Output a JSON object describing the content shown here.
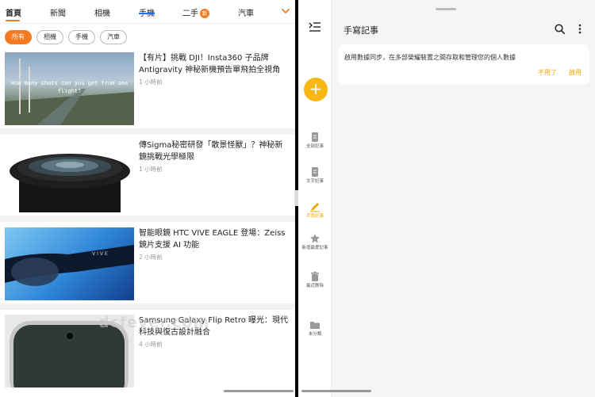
{
  "news": {
    "tabs": [
      {
        "label": "首頁"
      },
      {
        "label": "新聞"
      },
      {
        "label": "相機"
      },
      {
        "label": "手機"
      },
      {
        "label": "二手",
        "badge": "新"
      },
      {
        "label": "汽車"
      }
    ],
    "filter_chips": [
      "所有",
      "相機",
      "手機",
      "汽車"
    ],
    "articles": [
      {
        "title": "【有片】挑戰 DJI！Insta360 子品牌 Antigravity 神秘新機預告單飛拍全視角",
        "time": "1 小時前",
        "thumb_caption": "How many shots can you get from one flight?"
      },
      {
        "title": "傳Sigma秘密研發「散景怪獸」？神秘新鏡挑戰光學極限",
        "time": "1 小時前"
      },
      {
        "title": "智能眼鏡 HTC VIVE EAGLE 登場：Zeiss 鏡片支援 AI 功能",
        "time": "2 小時前",
        "thumb_caption": "VIVE"
      },
      {
        "title": "Samsung Galaxy Flip Retro 曝光：現代科技與復古設計融合",
        "time": "4 小時前"
      }
    ],
    "watermark": "dcfever.com"
  },
  "notes": {
    "title": "手寫記事",
    "nav": [
      {
        "label": "全部記事",
        "icon": "note-icon"
      },
      {
        "label": "文字記事",
        "icon": "text-note-icon"
      },
      {
        "label": "手寫記事",
        "icon": "pen-icon",
        "active": true
      },
      {
        "label": "新增最愛記事",
        "icon": "star-icon"
      },
      {
        "label": "最近刪除",
        "icon": "trash-icon"
      },
      {
        "label": "未分類",
        "icon": "folder-icon"
      }
    ],
    "sync_card": {
      "message": "啟用數據同步，在多部榮耀裝置之間存取和管理您的個人數據",
      "later_label": "不用了",
      "enable_label": "啟用"
    },
    "fab_label": "+"
  },
  "colors": {
    "accent_news": "#f47a20",
    "accent_notes": "#f2a400"
  }
}
